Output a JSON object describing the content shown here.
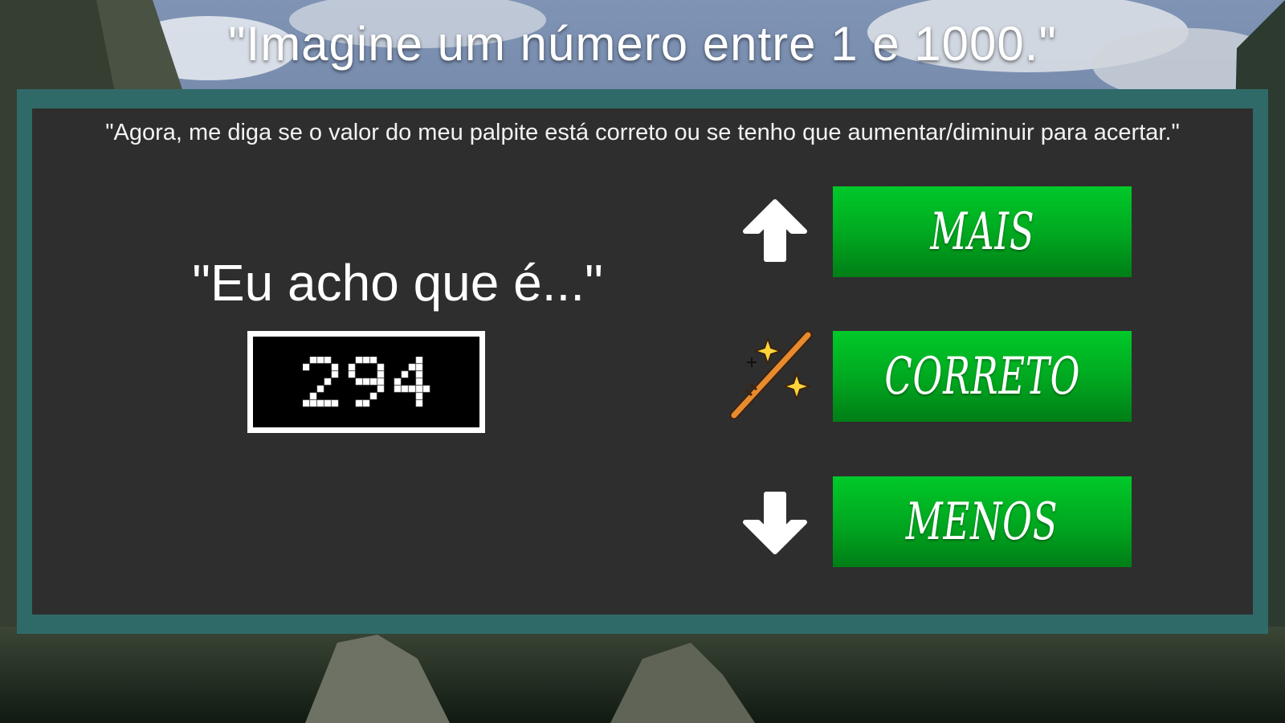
{
  "game": {
    "title": "\"Imagine um número entre 1 e 1000.\"",
    "instruction": "\"Agora, me diga se o valor do meu palpite está correto ou se tenho que aumentar/diminuir para acertar.\"",
    "guess_label": "\"Eu acho que é...\"",
    "guess_value": "294",
    "buttons": {
      "more": "MAIS",
      "correct": "CORRETO",
      "less": "MENOS"
    },
    "icons": {
      "more": "arrow-up-icon",
      "correct": "magic-wand-icon",
      "less": "arrow-down-icon"
    }
  },
  "colors": {
    "panel_border": "#2f6a68",
    "panel_background": "#2f2e2e",
    "button_green": "#00b824",
    "guess_box_background": "#000000",
    "guess_box_border": "#ffffff"
  }
}
